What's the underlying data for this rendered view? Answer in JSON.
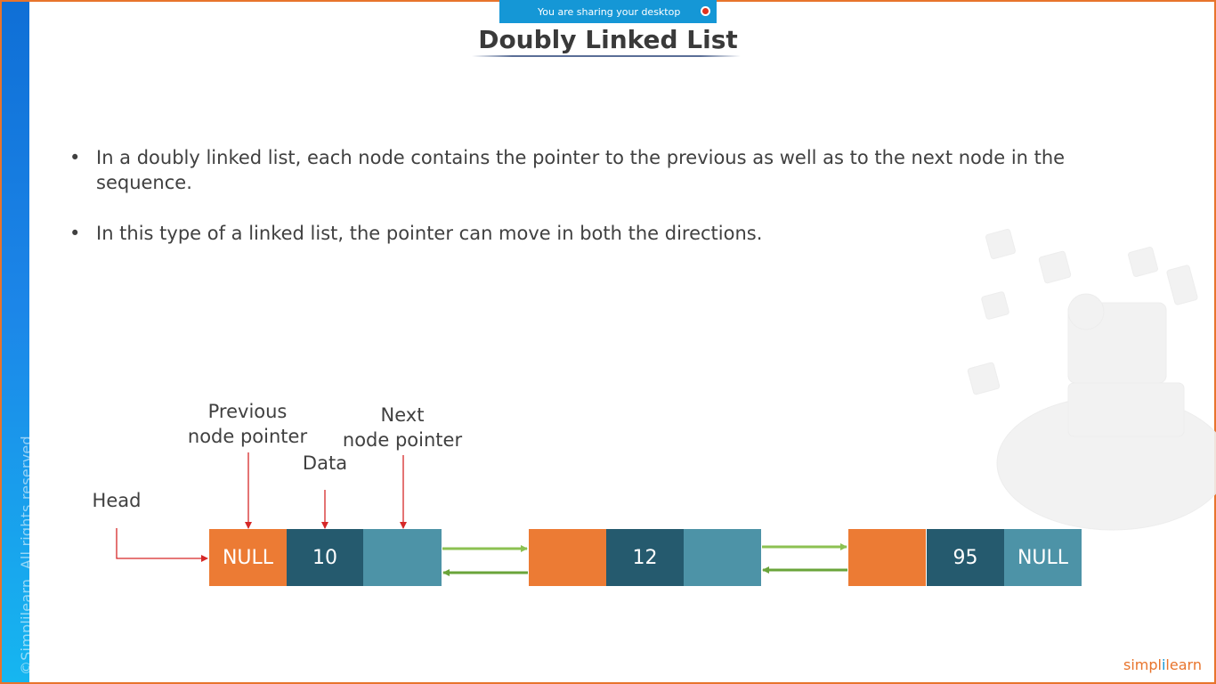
{
  "share_banner": {
    "text": "You are sharing your desktop"
  },
  "side_strip": {
    "copyright": "©Simplilearn. All rights reserved."
  },
  "slide": {
    "title": "Doubly Linked List",
    "bullets": [
      "In a doubly linked list, each node contains the pointer to the previous as well as to the next node in the sequence.",
      "In this type of a linked list, the pointer can move in both the directions."
    ]
  },
  "diagram": {
    "labels": {
      "head": "Head",
      "previous_pointer_line1": "Previous",
      "previous_pointer_line2": "node pointer",
      "data": "Data",
      "next_pointer_line1": "Next",
      "next_pointer_line2": "node pointer"
    },
    "nodes": [
      {
        "prev": "NULL",
        "data": "10",
        "next": ""
      },
      {
        "prev": "",
        "data": "12",
        "next": ""
      },
      {
        "prev": "",
        "data": "95",
        "next": "NULL"
      }
    ]
  },
  "logo": {
    "part1": "simpl",
    "separator": "i",
    "part2": "learn"
  },
  "colors": {
    "frame_border": "#e8742c",
    "prev_cell": "#ec7b34",
    "data_cell": "#255a6e",
    "next_cell": "#4d93a7",
    "label_arrow": "#d62828",
    "forward_arrow": "#8cc152",
    "backward_arrow": "#6aa43a"
  }
}
